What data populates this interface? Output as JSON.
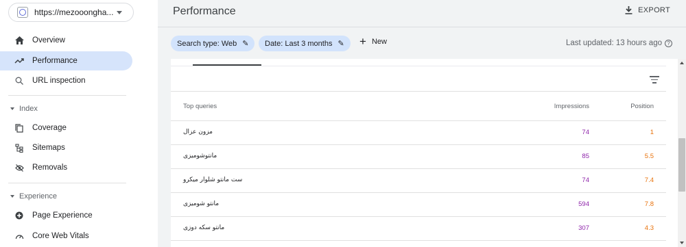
{
  "sidebar": {
    "property": {
      "label": "https://mezooongha...",
      "icon": "globe-icon"
    },
    "items": [
      {
        "label": "Overview",
        "icon": "home-icon"
      },
      {
        "label": "Performance",
        "icon": "trending-up-icon",
        "active": true
      },
      {
        "label": "URL inspection",
        "icon": "search-icon"
      }
    ],
    "index_section": {
      "label": "Index",
      "items": [
        {
          "label": "Coverage",
          "icon": "coverage-icon"
        },
        {
          "label": "Sitemaps",
          "icon": "sitemap-icon"
        },
        {
          "label": "Removals",
          "icon": "removals-icon"
        }
      ]
    },
    "experience_section": {
      "label": "Experience",
      "items": [
        {
          "label": "Page Experience",
          "icon": "page-experience-icon"
        },
        {
          "label": "Core Web Vitals",
          "icon": "gauge-icon"
        }
      ]
    }
  },
  "header": {
    "title": "Performance",
    "export_label": "EXPORT"
  },
  "filters": {
    "chips": [
      {
        "label": "Search type: Web"
      },
      {
        "label": "Date: Last 3 months"
      }
    ],
    "new_label": "New",
    "last_updated": "Last updated: 13 hours ago"
  },
  "table": {
    "columns": {
      "query": "Top queries",
      "impressions": "Impressions",
      "position": "Position"
    },
    "rows": [
      {
        "query": "مزون عزال",
        "impressions": "74",
        "position": "1"
      },
      {
        "query": "مانتوشومیزی",
        "impressions": "85",
        "position": "5.5"
      },
      {
        "query": "ست مانتو شلوار میکرو",
        "impressions": "74",
        "position": "7.4"
      },
      {
        "query": "مانتو شومیزی",
        "impressions": "594",
        "position": "7.8"
      },
      {
        "query": "مانتو سکه دوزی",
        "impressions": "307",
        "position": "4.3"
      }
    ]
  },
  "colors": {
    "active_nav": "#d6e4fb",
    "chip": "#d2e3fc",
    "impressions": "#8e24aa",
    "position": "#e8710a"
  }
}
